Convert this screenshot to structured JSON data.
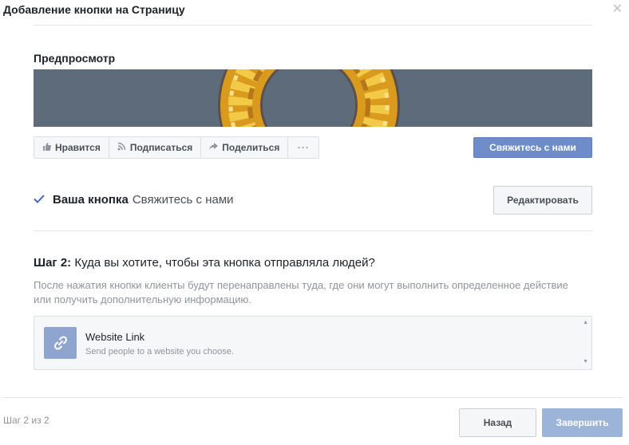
{
  "dialog": {
    "title": "Добавление кнопки на Страницу",
    "close_icon": "close-icon"
  },
  "preview": {
    "heading": "Предпросмотр",
    "actions": [
      {
        "label": "Нравится",
        "icon": "thumbs-up-icon"
      },
      {
        "label": "Подписаться",
        "icon": "rss-icon"
      },
      {
        "label": "Поделиться",
        "icon": "share-arrow-icon"
      },
      {
        "label": "···",
        "icon": "more-dots-icon"
      }
    ],
    "cta_label": "Свяжитесь с нами",
    "cta_color": "#6d8cc8"
  },
  "your_button": {
    "label": "Ваша кнопка",
    "value": "Свяжитесь с нами",
    "edit_label": "Редактировать"
  },
  "step": {
    "prefix": "Шаг 2:",
    "question": "Куда вы хотите, чтобы эта кнопка отправляла людей?",
    "description": "После нажатия кнопки клиенты будут перенаправлены туда, где они могут выполнить определенное действие или получить дополнительную информацию.",
    "options": [
      {
        "title": "Website Link",
        "subtitle": "Send people to a website you choose.",
        "icon": "link-icon"
      }
    ]
  },
  "footer": {
    "step_counter": "Шаг 2 из 2",
    "back_label": "Назад",
    "finish_label": "Завершить",
    "finish_color": "#9cb4d8"
  }
}
